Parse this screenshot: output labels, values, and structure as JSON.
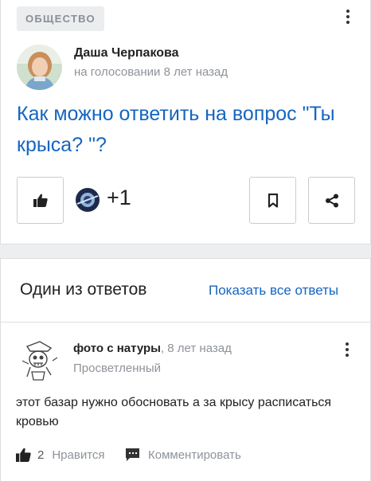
{
  "question_card": {
    "category": "ОБЩЕСТВО",
    "author": {
      "name": "Даша Черпакова",
      "meta": "на голосовании 8 лет назад"
    },
    "question": "Как можно ответить на вопрос \"Ты крыса? \"?",
    "votes": "+1"
  },
  "answers": {
    "title": "Один из ответов",
    "show_all": "Показать все ответы",
    "answer": {
      "author_name": "фото с натуры",
      "time": ", 8 лет назад",
      "rank": "Просветленный",
      "text": "этот базар нужно обосновать а за крысу расписаться кровью",
      "like_count": "2",
      "like_label": "Нравится",
      "comment_label": "Комментировать"
    }
  },
  "colors": {
    "accent": "#1565c0",
    "muted": "#8e9399",
    "separator": "#eceef0"
  }
}
